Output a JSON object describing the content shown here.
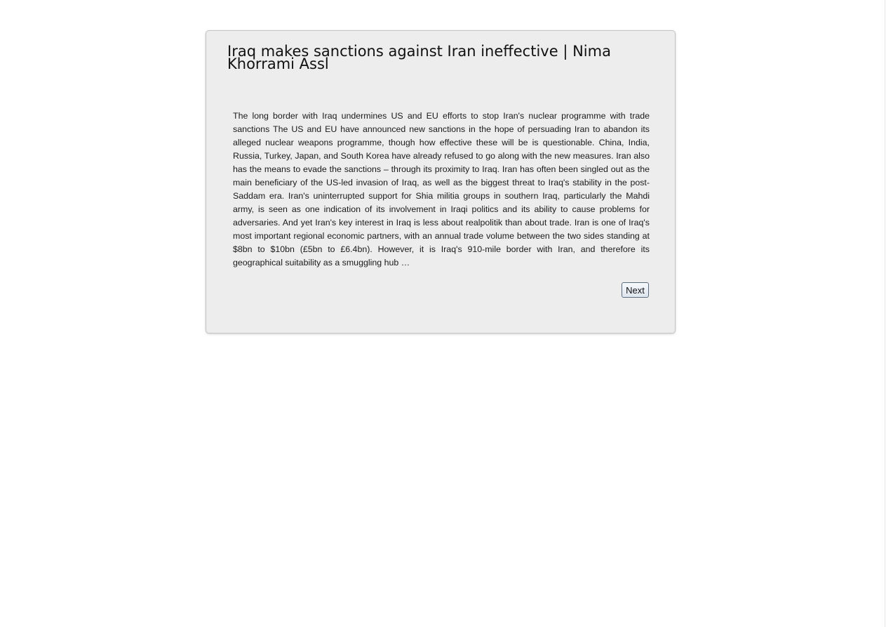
{
  "article": {
    "title": "Iraq makes sanctions against Iran ineffective | Nima Khorrami Assl",
    "body": "The long border with Iraq undermines US and EU efforts to stop Iran's nuclear programme with trade sanctions The US and EU have announced new sanctions in the hope of persuading Iran to abandon its alleged nuclear weapons programme, though how effective these will be is questionable. China, India, Russia, Turkey, Japan, and South Korea have already refused to go along with the new measures. Iran also has the means to evade the sanctions – through its proximity to Iraq. Iran has often been singled out as the main beneficiary of the US-led invasion of Iraq, as well as the biggest threat to Iraq's stability in the post-Saddam era. Iran's uninterrupted support for Shia militia groups in southern Iraq, particularly the Mahdi army, is seen as one indication of its involvement in Iraqi politics and its ability to cause problems for adversaries. And yet Iran's key interest in Iraq is less about realpolitik than about trade. Iran is one of Iraq's most important regional economic partners, with an annual trade volume between the two sides standing at $8bn to $10bn (£5bn to £6.4bn). However, it is Iraq's 910-mile border with Iran, and therefore its geographical suitability as a smuggling hub …"
  },
  "controls": {
    "next_label": "Next"
  }
}
